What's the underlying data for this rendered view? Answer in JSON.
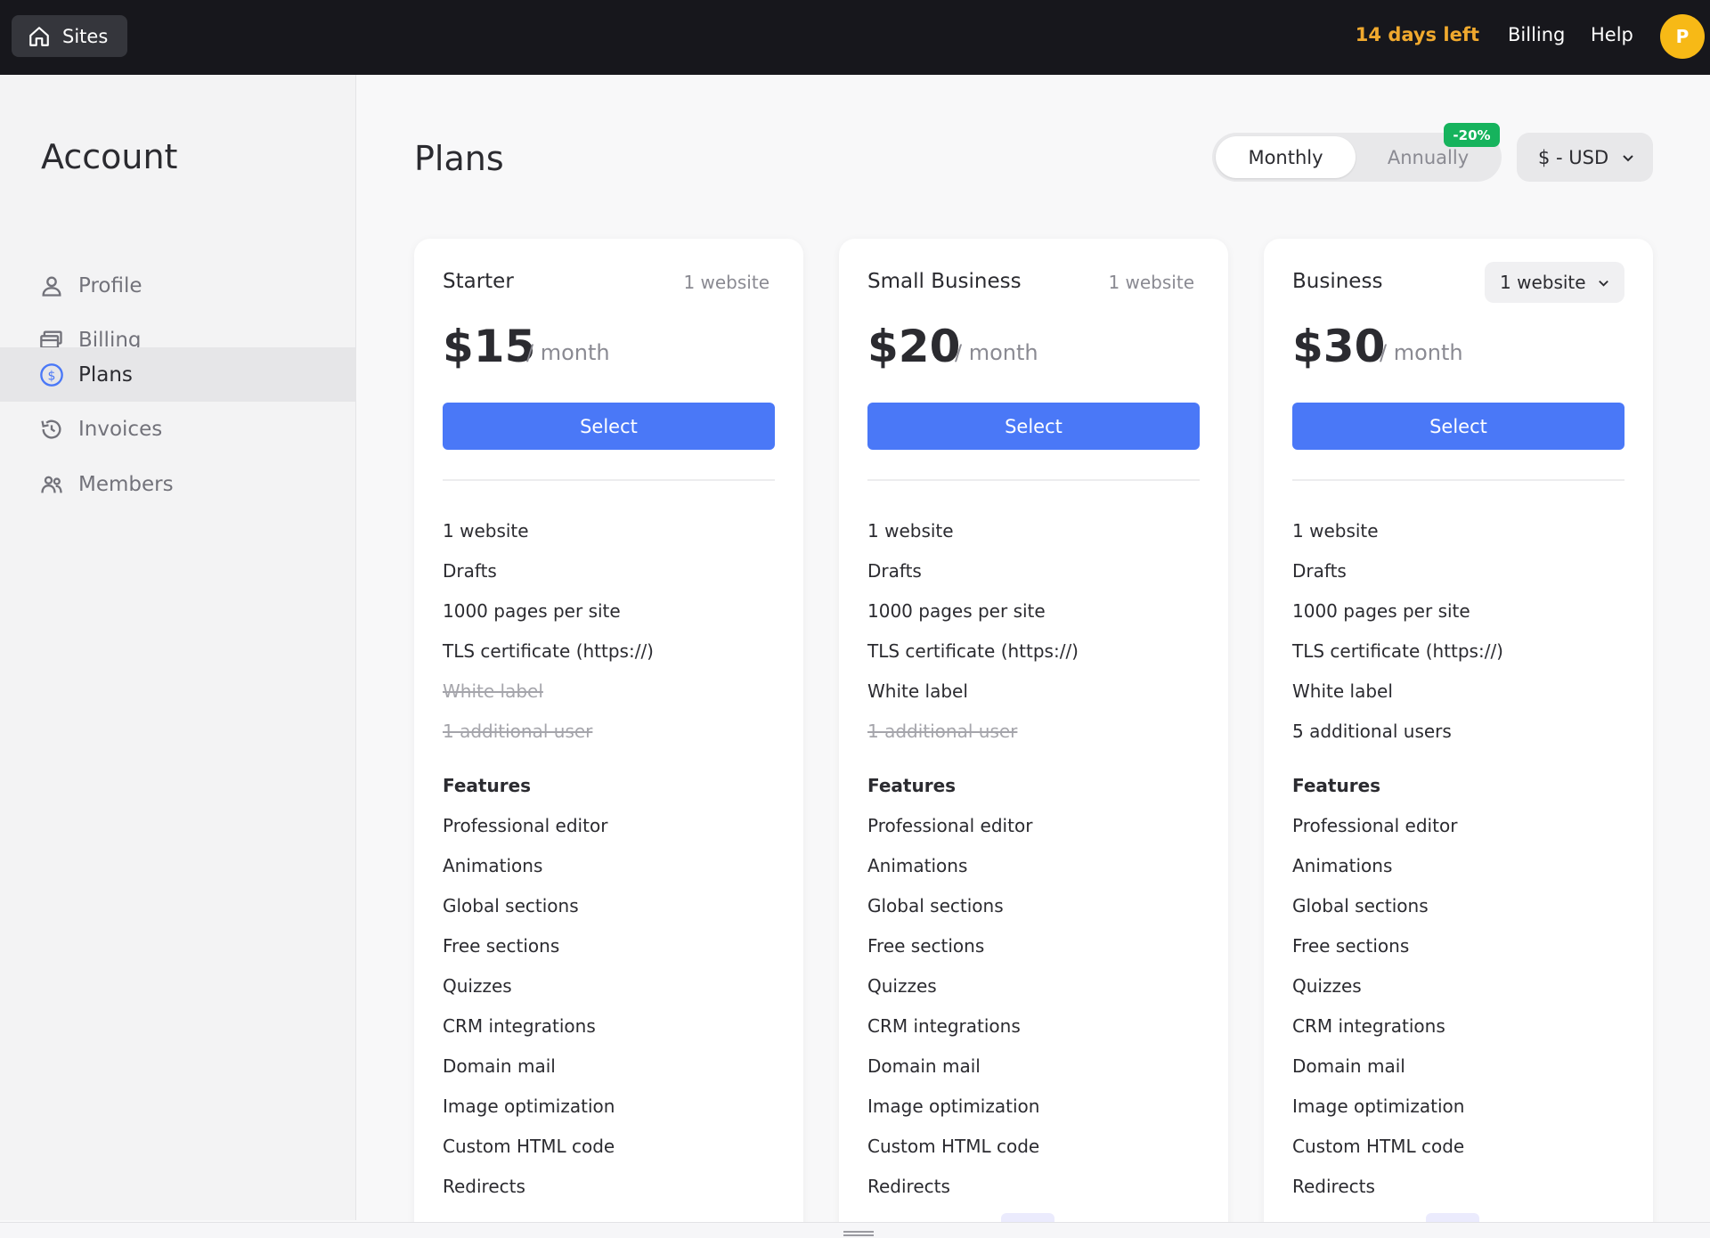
{
  "topbar": {
    "sites_label": "Sites",
    "trial_text": "14 days left",
    "billing_link": "Billing",
    "help_link": "Help",
    "avatar_initial": "P",
    "trial_color": "#f0a92e",
    "avatar_color": "#f7b916"
  },
  "sidebar": {
    "title": "Account",
    "items": [
      {
        "label": "Profile",
        "icon": "user-icon"
      },
      {
        "label": "Billing",
        "icon": "card-icon"
      },
      {
        "label": "Plans",
        "icon": "dollar-circle-icon",
        "active": true
      },
      {
        "label": "Invoices",
        "icon": "history-icon"
      },
      {
        "label": "Members",
        "icon": "users-icon"
      }
    ]
  },
  "main": {
    "title": "Plans",
    "billing_period": {
      "monthly": "Monthly",
      "annually": "Annually",
      "discount": "-20%",
      "selected": "Monthly"
    },
    "currency": "$ - USD",
    "accent_color": "#4a78f7",
    "plans": [
      {
        "name": "Starter",
        "sites": "1 website",
        "price": "$15",
        "period": "/ month",
        "button": "Select",
        "limits": [
          {
            "text": "1 website",
            "included": true
          },
          {
            "text": "Drafts",
            "included": true
          },
          {
            "text": "1000 pages per site",
            "included": true
          },
          {
            "text": "TLS certificate (https://)",
            "included": true
          },
          {
            "text": "White label",
            "included": false
          },
          {
            "text": "1 additional user",
            "included": false
          }
        ],
        "features_heading": "Features",
        "features": [
          "Professional editor",
          "Animations",
          "Global sections",
          "Free sections",
          "Quizzes",
          "CRM integrations",
          "Domain mail",
          "Image optimization",
          "Custom HTML code",
          "Redirects"
        ]
      },
      {
        "name": "Small Business",
        "sites": "1 website",
        "price": "$20",
        "period": "/ month",
        "button": "Select",
        "limits": [
          {
            "text": "1 website",
            "included": true
          },
          {
            "text": "Drafts",
            "included": true
          },
          {
            "text": "1000 pages per site",
            "included": true
          },
          {
            "text": "TLS certificate (https://)",
            "included": true
          },
          {
            "text": "White label",
            "included": true
          },
          {
            "text": "1 additional user",
            "included": false
          }
        ],
        "features_heading": "Features",
        "features": [
          "Professional editor",
          "Animations",
          "Global sections",
          "Free sections",
          "Quizzes",
          "CRM integrations",
          "Domain mail",
          "Image optimization",
          "Custom HTML code",
          "Redirects"
        ]
      },
      {
        "name": "Business",
        "sites": "1 website",
        "price": "$30",
        "period": "/ month",
        "button": "Select",
        "limits": [
          {
            "text": "1 website",
            "included": true
          },
          {
            "text": "Drafts",
            "included": true
          },
          {
            "text": "1000 pages per site",
            "included": true
          },
          {
            "text": "TLS certificate (https://)",
            "included": true
          },
          {
            "text": "White label",
            "included": true
          },
          {
            "text": "5 additional users",
            "included": true
          }
        ],
        "features_heading": "Features",
        "features": [
          "Professional editor",
          "Animations",
          "Global sections",
          "Free sections",
          "Quizzes",
          "CRM integrations",
          "Domain mail",
          "Image optimization",
          "Custom HTML code",
          "Redirects"
        ]
      }
    ]
  }
}
